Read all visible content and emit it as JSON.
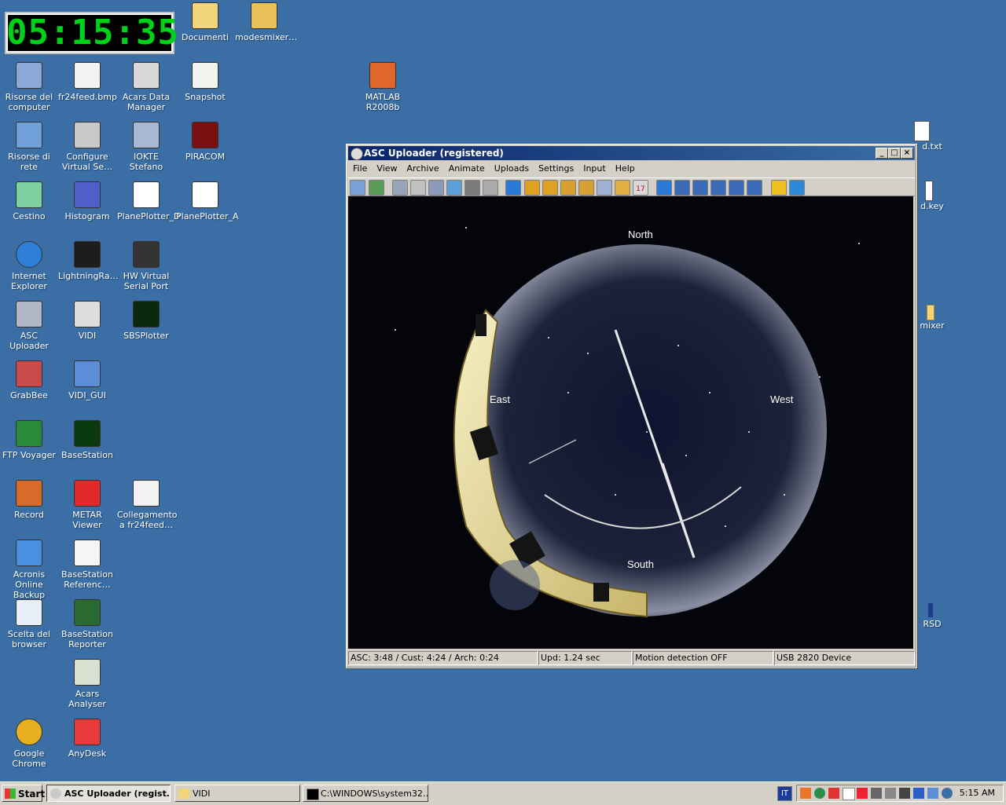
{
  "clock": {
    "time": "05:15:35"
  },
  "desktop": {
    "icons": [
      {
        "label": "Documenti",
        "icon": "folder-docs-icon"
      },
      {
        "label": "modesmixer…",
        "icon": "zip-folder-icon"
      },
      {
        "label": "Risorse del computer",
        "icon": "my-computer-icon"
      },
      {
        "label": "fr24feed.bmp",
        "icon": "bitmap-icon"
      },
      {
        "label": "Acars Data Manager",
        "icon": "acars-plane-icon"
      },
      {
        "label": "Snapshot",
        "icon": "snapshot-icon"
      },
      {
        "label": "MATLAB R2008b",
        "icon": "matlab-icon"
      },
      {
        "label": "Risorse di rete",
        "icon": "network-icon"
      },
      {
        "label": "Configure Virtual Se…",
        "icon": "configure-serial-icon"
      },
      {
        "label": "IOKTE Stefano",
        "icon": "network-share-icon"
      },
      {
        "label": "PIRACOM",
        "icon": "piracom-icon"
      },
      {
        "label": "Cestino",
        "icon": "recycle-bin-icon"
      },
      {
        "label": "Histogram",
        "icon": "histogram-icon"
      },
      {
        "label": "PlanePlotter_D",
        "icon": "planeplotter-icon"
      },
      {
        "label": "PlanePlotter_A",
        "icon": "planeplotter-icon"
      },
      {
        "label": "Internet Explorer",
        "icon": "internet-explorer-icon"
      },
      {
        "label": "LightningRa…",
        "icon": "lightning-radar-icon"
      },
      {
        "label": "HW Virtual Serial Port",
        "icon": "virtual-serial-icon"
      },
      {
        "label": "ASC Uploader",
        "icon": "asc-uploader-icon"
      },
      {
        "label": "VIDI",
        "icon": "camera-icon"
      },
      {
        "label": "SBSPlotter",
        "icon": "sbs-plotter-icon"
      },
      {
        "label": "GrabBee",
        "icon": "grabbee-icon"
      },
      {
        "label": "VIDI_GUI",
        "icon": "vidi-gui-icon"
      },
      {
        "label": "FTP Voyager",
        "icon": "ftp-voyager-icon"
      },
      {
        "label": "BaseStation",
        "icon": "basestation-radar-icon"
      },
      {
        "label": "Record",
        "icon": "record-icon"
      },
      {
        "label": "METAR Viewer",
        "icon": "thermometer-icon"
      },
      {
        "label": "Collegamento a fr24feed…",
        "icon": "console-window-icon"
      },
      {
        "label": "Acronis Online Backup",
        "icon": "acronis-icon"
      },
      {
        "label": "BaseStation Referenc…",
        "icon": "document-icon"
      },
      {
        "label": "Scelta del browser",
        "icon": "browser-choice-icon"
      },
      {
        "label": "BaseStation Reporter",
        "icon": "basestation-reporter-icon"
      },
      {
        "label": "Acars Analyser",
        "icon": "acars-analyser-icon"
      },
      {
        "label": "Google Chrome",
        "icon": "chrome-icon"
      },
      {
        "label": "AnyDesk",
        "icon": "anydesk-icon"
      }
    ],
    "partial_labels": {
      "txt": "d.txt",
      "key": "d.key",
      "mixer": "mixer",
      "rsd": "RSD"
    }
  },
  "window": {
    "title": "ASC Uploader (registered)",
    "menu": [
      "File",
      "View",
      "Archive",
      "Animate",
      "Uploads",
      "Settings",
      "Input",
      "Help"
    ],
    "toolbar_icons": [
      "save-icon",
      "upload-icon",
      "globe-icon",
      "bar-icon",
      "image-icon",
      "globe2-icon",
      "histogram-icon",
      "camera-icon",
      "play-icon",
      "cam-a-icon",
      "cam-b-icon",
      "cam-c-icon",
      "cam-d-icon",
      "list-a-icon",
      "list-b-icon",
      "calendar-icon",
      "play2-icon",
      "film-a-icon",
      "film-b-icon",
      "film-24-icon",
      "film-c-icon",
      "film-d-icon",
      "star-icon",
      "compass-icon"
    ],
    "calendar_label": "17",
    "sky_labels": {
      "north": "North",
      "east": "East",
      "west": "West",
      "south": "South"
    },
    "status": {
      "timing": "ASC: 3:48 / Cust: 4:24 / Arch: 0:24",
      "update": "Upd: 1.24 sec",
      "motion": "Motion detection OFF",
      "device": "USB 2820 Device"
    }
  },
  "taskbar": {
    "start": "Start",
    "buttons": [
      {
        "label": "ASC Uploader (regist…",
        "active": true
      },
      {
        "label": "VIDI",
        "active": false
      },
      {
        "label": "C:\\WINDOWS\\system32…",
        "active": false
      }
    ],
    "language": "IT",
    "time": "5:15 AM"
  }
}
